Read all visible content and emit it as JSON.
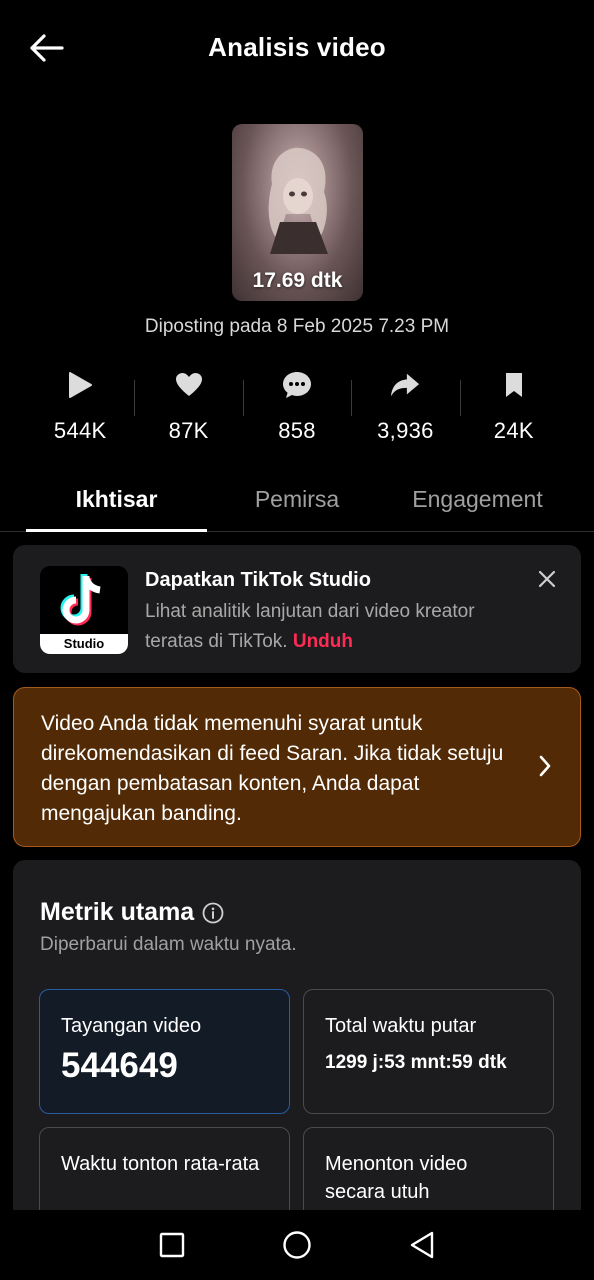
{
  "header": {
    "title": "Analisis video"
  },
  "video": {
    "duration": "17.69 dtk",
    "posted": "Diposting pada 8 Feb 2025 7.23 PM"
  },
  "stats": [
    {
      "icon": "play-icon",
      "value": "544K"
    },
    {
      "icon": "heart-icon",
      "value": "87K"
    },
    {
      "icon": "comment-icon",
      "value": "858"
    },
    {
      "icon": "share-icon",
      "value": "3,936"
    },
    {
      "icon": "bookmark-icon",
      "value": "24K"
    }
  ],
  "tabs": [
    {
      "label": "Ikhtisar",
      "active": true
    },
    {
      "label": "Pemirsa",
      "active": false
    },
    {
      "label": "Engagement",
      "active": false
    }
  ],
  "promo": {
    "logo_label": "Studio",
    "title": "Dapatkan TikTok Studio",
    "desc": "Lihat analitik lanjutan dari video kreator teratas di TikTok.",
    "link": "Unduh"
  },
  "warning": {
    "text": "Video Anda tidak memenuhi syarat untuk direkomendasikan di feed Saran. Jika tidak setuju dengan pembatasan konten, Anda dapat mengajukan banding."
  },
  "metrics": {
    "title": "Metrik utama",
    "subtitle": "Diperbarui dalam waktu nyata.",
    "boxes": [
      {
        "label": "Tayangan video",
        "value": "544649"
      },
      {
        "label": "Total waktu putar",
        "value": "1299 j:53 mnt:59 dtk"
      },
      {
        "label": "Waktu tonton rata-rata",
        "value": ""
      },
      {
        "label": "Menonton video secara utuh",
        "value": ""
      }
    ]
  },
  "colors": {
    "accent": "#fe2c55",
    "warning_bg": "#522b06",
    "warning_border": "#a55a1d",
    "card_bg": "#1c1c1e",
    "active_border": "#2a5ba0"
  }
}
